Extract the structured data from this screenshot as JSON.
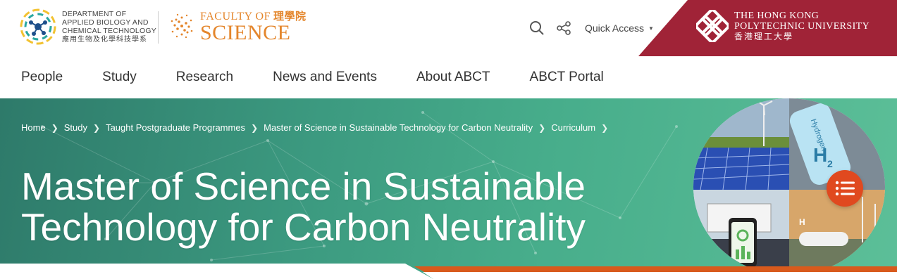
{
  "header": {
    "dept_lines": [
      "Department of",
      "Applied Biology and",
      "Chemical Technology"
    ],
    "dept_zh": "應用生物及化學科技學系",
    "faculty_top": "Faculty of",
    "faculty_zh": "理學院",
    "faculty_big": "Science",
    "quick_access": "Quick Access",
    "university_lines": [
      "The Hong Kong",
      "Polytechnic University"
    ],
    "university_zh": "香港理工大學",
    "colors": {
      "brand_red": "#a02337",
      "faculty_orange": "#e4862c",
      "accent_orange": "#e0491f",
      "hero_green": "#47ad8b"
    },
    "icons": [
      "search-icon",
      "share-icon",
      "caret-down-icon"
    ]
  },
  "nav": {
    "items": [
      "People",
      "Study",
      "Research",
      "News and Events",
      "About ABCT",
      "ABCT Portal"
    ]
  },
  "breadcrumb": [
    "Home",
    "Study",
    "Taught Postgraduate Programmes",
    "Master of Science in Sustainable Technology for Carbon Neutrality",
    "Curriculum"
  ],
  "hero": {
    "title_line1": "Master of Science in Sustainable",
    "title_line2": "Technology for Carbon Neutrality",
    "image_text": {
      "hydrogen": "Hydrogen",
      "h2": "H",
      "h2_sub": "2",
      "tank": "H"
    }
  }
}
